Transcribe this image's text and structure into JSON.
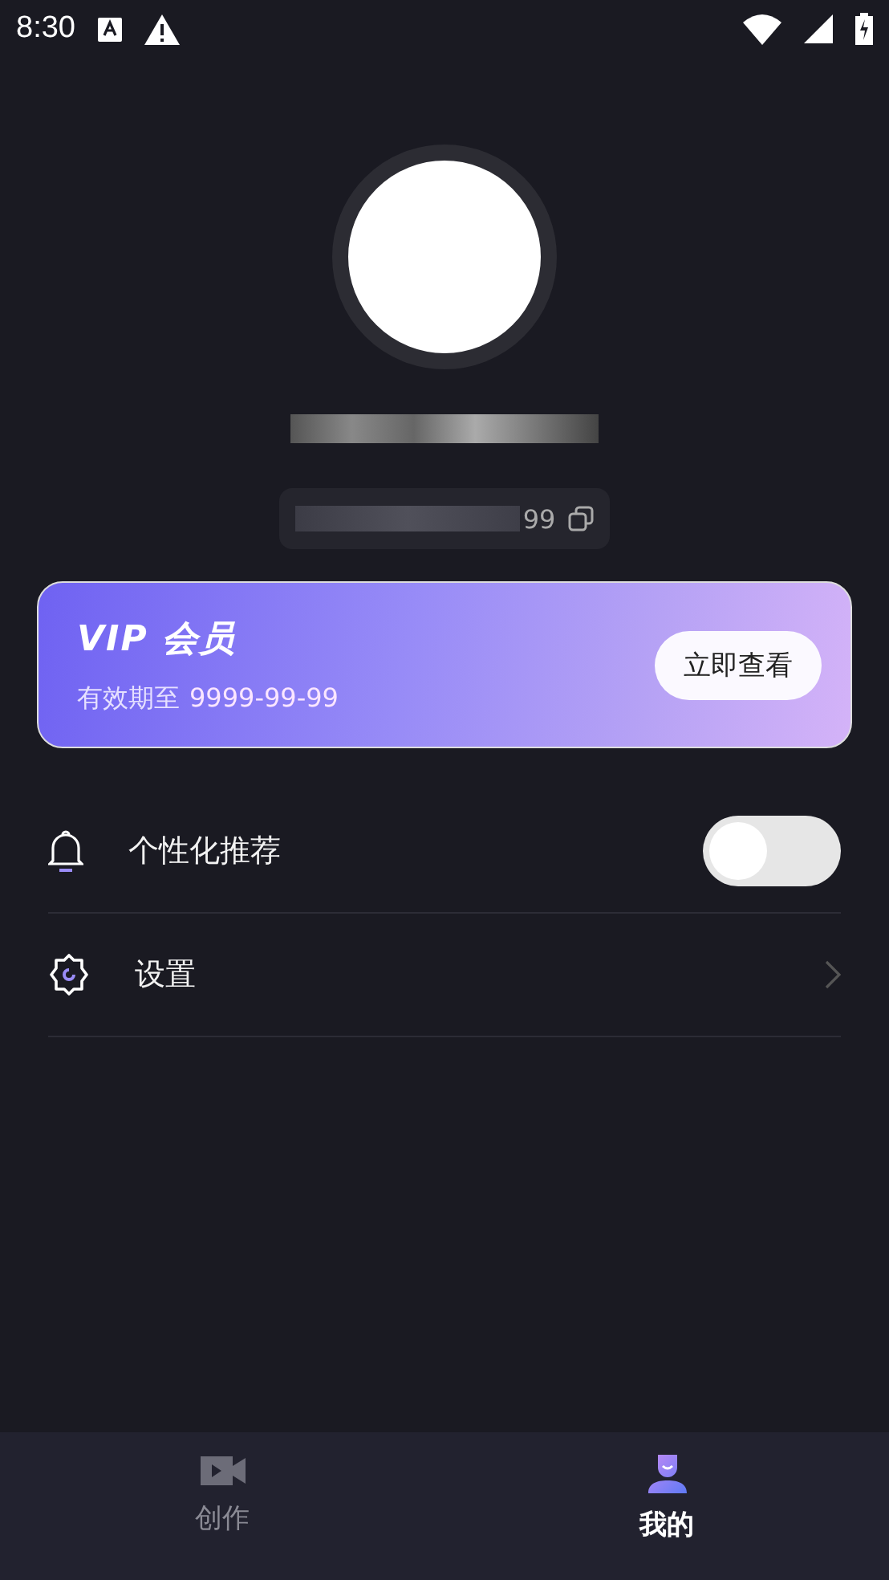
{
  "status_bar": {
    "time": "8:30"
  },
  "profile": {
    "id_suffix": "99"
  },
  "vip_card": {
    "title": "VIP 会员",
    "validity_label": "有效期至",
    "validity_date": "9999-99-99",
    "button": "立即查看"
  },
  "menu": [
    {
      "kind": "toggle",
      "label": "个性化推荐",
      "on": false
    },
    {
      "kind": "link",
      "label": "设置"
    }
  ],
  "tabs": [
    {
      "kind": "video",
      "label": "创作",
      "selected": false
    },
    {
      "kind": "user",
      "label": "我的",
      "selected": true
    }
  ]
}
